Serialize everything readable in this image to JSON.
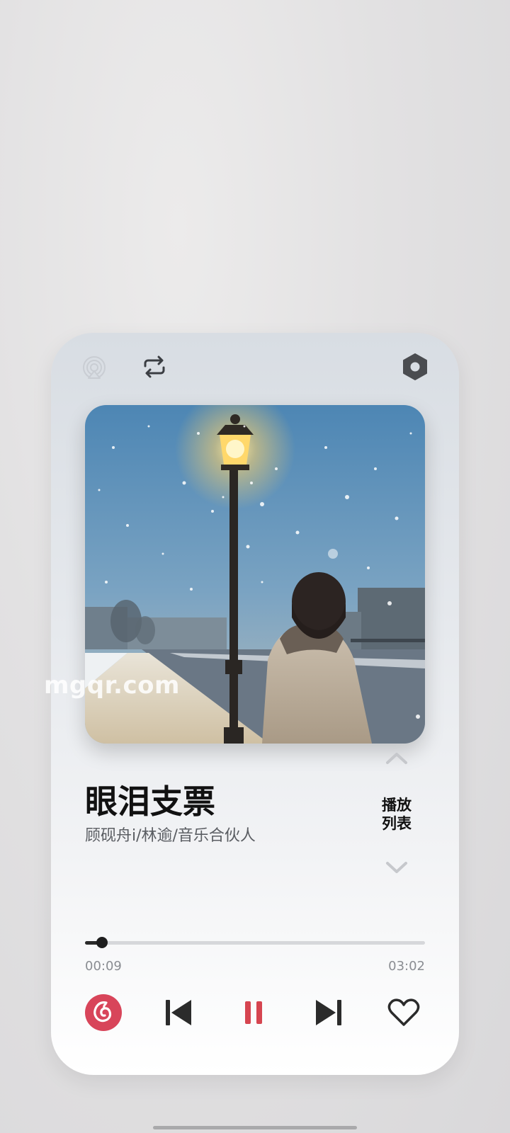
{
  "song": {
    "title": "眼泪支票",
    "artist": "顾砚舟i/林逾/音乐合伙人"
  },
  "playlist": {
    "label": "播放列表"
  },
  "progress": {
    "elapsed": "00:09",
    "total": "03:02",
    "fraction": 0.05
  },
  "watermark": "mgqr.com",
  "icons": {
    "airplay": "airplay-icon",
    "repeat": "repeat-icon",
    "settings": "hexagon-settings-icon",
    "app_logo": "netease-music-logo-icon",
    "previous": "skip-previous-icon",
    "pause": "pause-icon",
    "next": "skip-next-icon",
    "favorite": "heart-icon",
    "playlist_up": "chevron-up-icon",
    "playlist_down": "chevron-down-icon"
  },
  "colors": {
    "accent": "#d64550",
    "logo": "#d8455a",
    "primary_text": "#111111",
    "secondary_text": "#5a5d62"
  }
}
